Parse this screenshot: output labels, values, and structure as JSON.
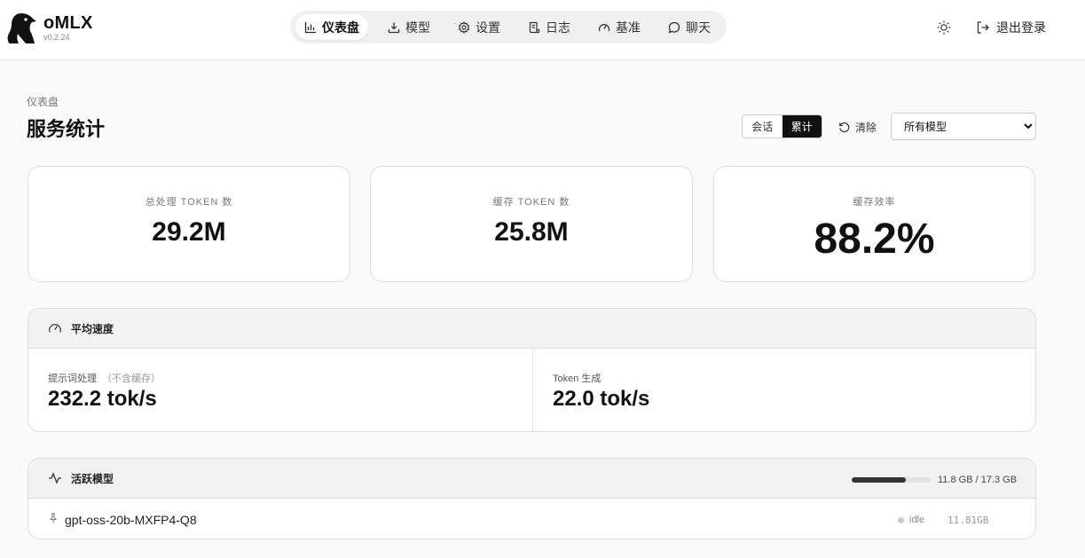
{
  "app": {
    "name": "oMLX",
    "version": "v0.2.24"
  },
  "nav": {
    "items": [
      {
        "label": "仪表盘",
        "icon": "bar-chart-icon",
        "active": true
      },
      {
        "label": "模型",
        "icon": "download-icon",
        "active": false
      },
      {
        "label": "设置",
        "icon": "gear-icon",
        "active": false
      },
      {
        "label": "日志",
        "icon": "log-icon",
        "active": false
      },
      {
        "label": "基准",
        "icon": "gauge-icon",
        "active": false
      },
      {
        "label": "聊天",
        "icon": "chat-icon",
        "active": false
      }
    ],
    "theme_icon": "sun-icon",
    "logout_label": "退出登录"
  },
  "page": {
    "breadcrumb": "仪表盘",
    "title": "服务统计",
    "scope_toggle": {
      "options": [
        "会话",
        "累计"
      ],
      "selected": "累计"
    },
    "clear_label": "清除",
    "model_filter": {
      "selected": "所有模型"
    }
  },
  "stats": [
    {
      "label": "总处理 TOKEN 数",
      "value": "29.2M"
    },
    {
      "label": "缓存 TOKEN 数",
      "value": "25.8M"
    },
    {
      "label": "缓存效率",
      "value": "88.2%"
    }
  ],
  "speed": {
    "title": "平均速度",
    "prompt_label": "提示词处理",
    "prompt_note": "（不含缓存）",
    "prompt_value": "232.2 tok/s",
    "gen_label": "Token 生成",
    "gen_value": "22.0 tok/s"
  },
  "active_models": {
    "title": "活跃模型",
    "memory_text": "11.8 GB / 17.3 GB",
    "memory_used_fraction": 0.68,
    "models": [
      {
        "name": "gpt-oss-20b-MXFP4-Q8",
        "status": "idle",
        "size": "11.81GB"
      }
    ]
  },
  "colors": {
    "accent": "#111111",
    "background": "#fafafa",
    "status_idle": "#cccccc"
  }
}
